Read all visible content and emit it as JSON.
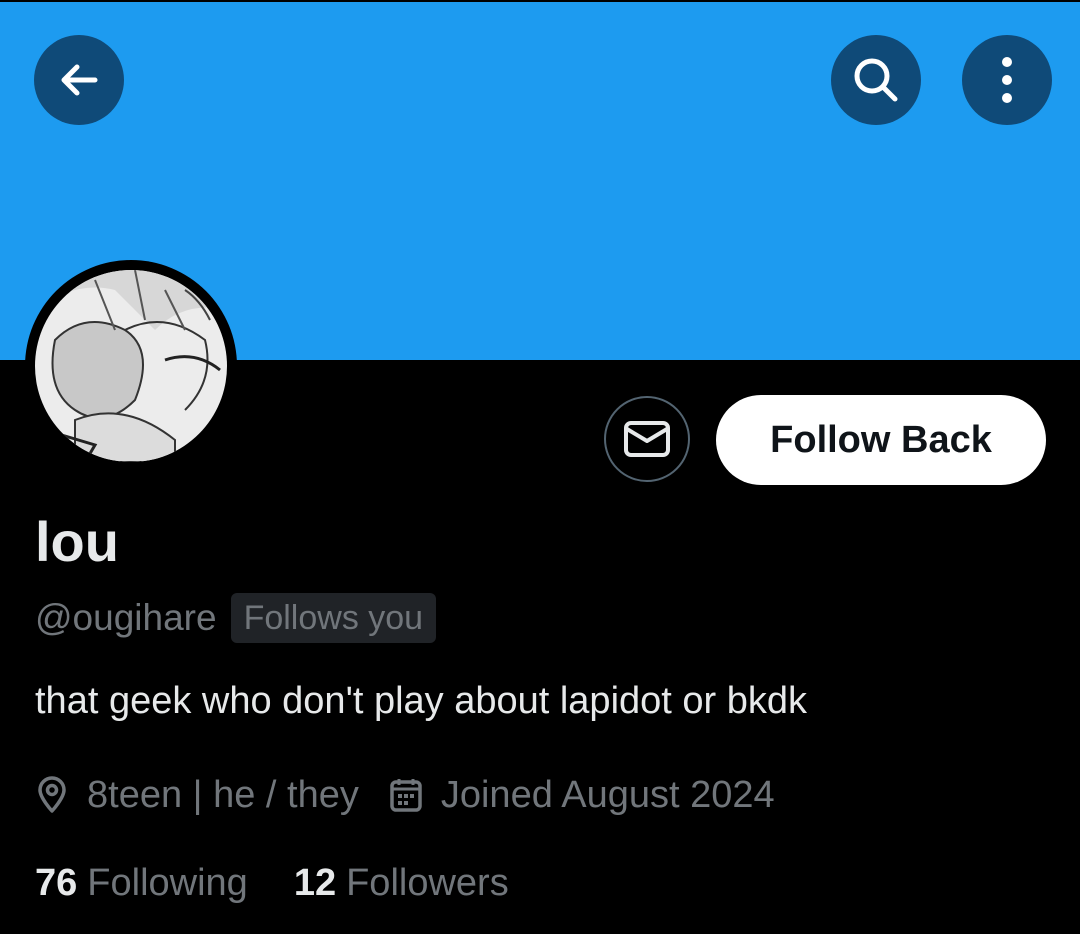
{
  "colors": {
    "banner": "#1d9bf0",
    "background": "#000000",
    "primary_text": "#e7e9ea",
    "secondary_text": "#71767b",
    "icon_button_bg": "#0f4a78"
  },
  "header": {
    "back_icon": "arrow-left-icon",
    "search_icon": "search-icon",
    "more_icon": "more-vertical-icon"
  },
  "profile": {
    "display_name": "lou",
    "handle": "@ougihare",
    "follows_you_badge": "Follows you",
    "bio": "that geek who don't play about lapidot or bkdk",
    "location": "8teen | he / they",
    "joined": "Joined August 2024",
    "avatar_icon": "manga-avatar-image"
  },
  "actions": {
    "message_icon": "mail-icon",
    "follow_back_label": "Follow Back"
  },
  "stats": {
    "following_count": "76",
    "following_label": "Following",
    "followers_count": "12",
    "followers_label": "Followers"
  }
}
